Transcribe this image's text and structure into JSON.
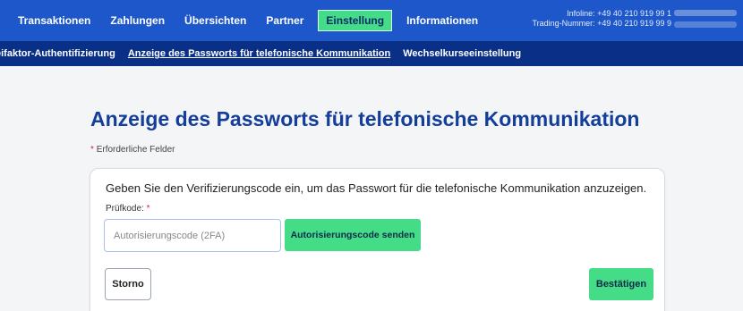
{
  "top_nav": {
    "items": [
      {
        "label": "Transaktionen"
      },
      {
        "label": "Zahlungen"
      },
      {
        "label": "Übersichten"
      },
      {
        "label": "Partner"
      },
      {
        "label": "Einstellung",
        "active": true
      },
      {
        "label": "Informationen"
      }
    ],
    "infoline": "Infoline: +49 40 210 919 99 1",
    "trading_number": "Trading-Nummer: +49 40 210 919 99 9"
  },
  "sub_nav": {
    "items": [
      {
        "label": "eifaktor-Authentifizierung"
      },
      {
        "label": "Anzeige des Passworts für telefonische Kommunikation",
        "active": true
      },
      {
        "label": "Wechselkurseeinstellung"
      }
    ]
  },
  "page": {
    "title": "Anzeige des Passworts für telefonische Kommunikation",
    "required_star": "*",
    "required_note": "Erforderliche Felder"
  },
  "form": {
    "instruction": "Geben Sie den Verifizierungscode ein, um das Passwort für die telefonische Kommunikation anzuzeigen.",
    "code_label": "Prüfkode:",
    "code_star": "*",
    "code_value": "",
    "code_placeholder": "Autorisierungscode (2FA)",
    "send_button": "Autorisierungscode senden",
    "cancel_button": "Storno",
    "confirm_button": "Bestätigen"
  },
  "colors": {
    "primary_blue": "#1d57c9",
    "dark_blue": "#0a2f86",
    "accent_green": "#44dc86",
    "title_blue": "#133e9a",
    "required_red": "#e0203a"
  }
}
